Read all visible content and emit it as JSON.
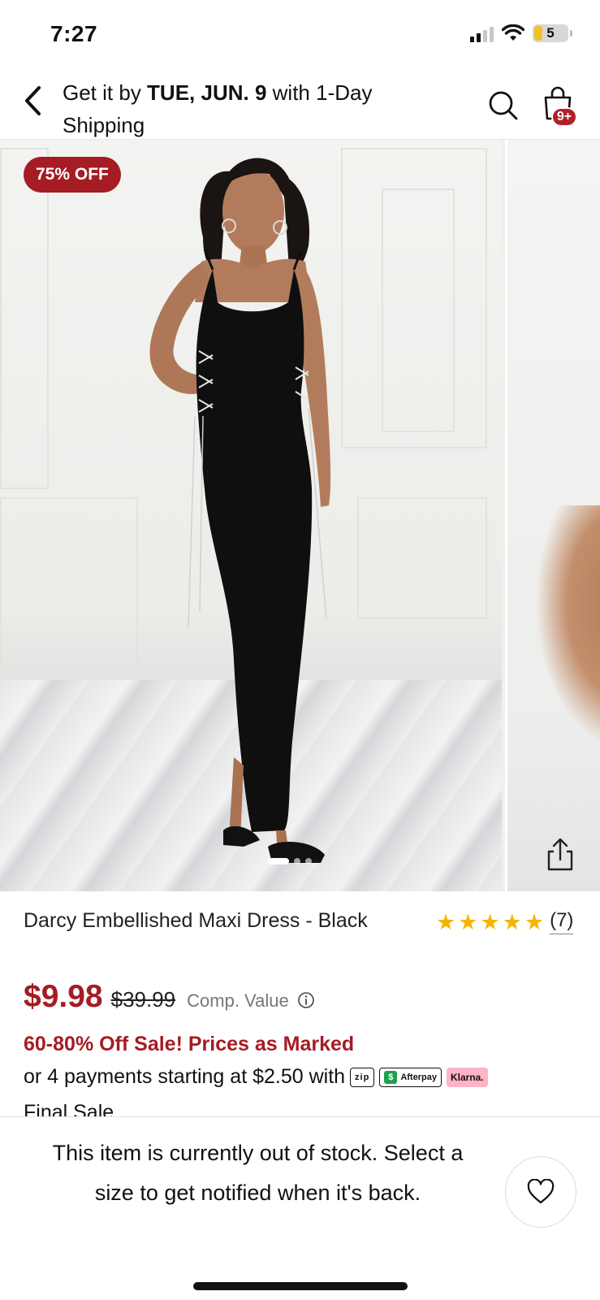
{
  "status_bar": {
    "time": "7:27",
    "battery_level": "5",
    "icons": [
      "signal-icon",
      "wifi-icon",
      "battery-icon"
    ]
  },
  "header": {
    "shipping_prefix": "Get it by ",
    "shipping_date": "TUE, JUN. 9",
    "shipping_suffix": " with 1-Day Shipping",
    "cart_badge": "9+",
    "icons": [
      "back-chevron-icon",
      "search-icon",
      "shopping-bag-icon"
    ]
  },
  "gallery": {
    "sale_badge": "75% OFF",
    "slide_count": 3,
    "active_slide": 1,
    "icons": [
      "share-icon"
    ]
  },
  "product": {
    "title": "Darcy Embellished Maxi Dress - Black",
    "rating_stars": 5,
    "review_count": "(7)",
    "price": "$9.98",
    "original_price": "$39.99",
    "comp_value_label": "Comp. Value",
    "sale_message": "60-80% Off Sale! Prices as Marked",
    "payments_text": "or 4 payments starting at $2.50 with",
    "payment_providers": [
      "zip",
      "Afterpay",
      "Klarna."
    ],
    "final_sale": "Final Sale"
  },
  "bottom_bar": {
    "out_of_stock_message": "This item is currently out of stock. Select a size to get notified when it's back.",
    "icons": [
      "heart-icon"
    ]
  },
  "colors": {
    "accent_red": "#a51c24",
    "star_yellow": "#f5b400",
    "afterpay_green": "#1aa34a",
    "klarna_pink": "#ffb3c7"
  }
}
